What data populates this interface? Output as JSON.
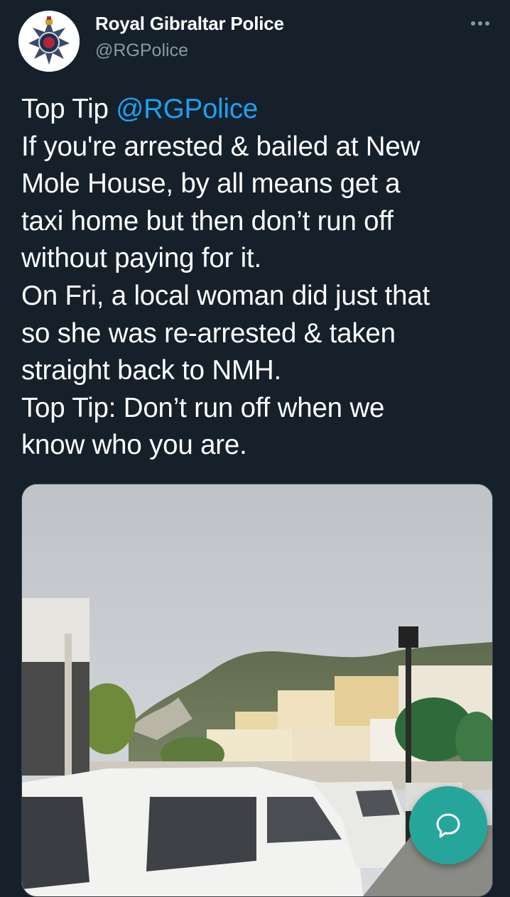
{
  "tweet": {
    "display_name": "Royal Gibraltar Police",
    "handle": "@RGPolice",
    "avatar_icon": "police-badge-icon",
    "more_icon": "more-dots-icon",
    "lines": [
      {
        "text": "Top Tip ",
        "mention": "@RGPolice"
      },
      {
        "text": "If you're arrested & bailed at New"
      },
      {
        "text": "Mole House, by all means get a"
      },
      {
        "text": "taxi home but then don’t run off"
      },
      {
        "text": "without paying for it."
      },
      {
        "text": "On Fri, a local woman did just that"
      },
      {
        "text": "so she was re-arrested & taken"
      },
      {
        "text": "straight back to NMH."
      },
      {
        "text": "Top Tip: Don’t run off when we"
      },
      {
        "text": "know who you are."
      }
    ],
    "media_icon": "photo-street-rock-taxis"
  },
  "fab": {
    "icon": "reply-bubble-icon"
  },
  "colors": {
    "background": "#15202b",
    "text": "#ffffff",
    "secondary": "#8899a6",
    "link": "#1da1f2",
    "fab": "#26a69a"
  }
}
